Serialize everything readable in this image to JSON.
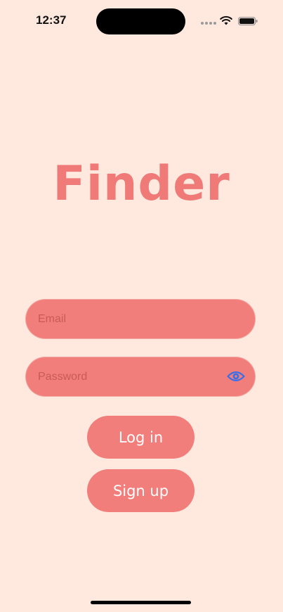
{
  "status_bar": {
    "time": "12:37"
  },
  "app": {
    "title": "Finder",
    "accent_color": "#F27E7C",
    "background_color": "#FFE8DD"
  },
  "form": {
    "email": {
      "placeholder": "Email",
      "value": ""
    },
    "password": {
      "placeholder": "Password",
      "value": "",
      "toggle_icon": "eye-icon"
    },
    "login_label": "Log in",
    "signup_label": "Sign up"
  }
}
